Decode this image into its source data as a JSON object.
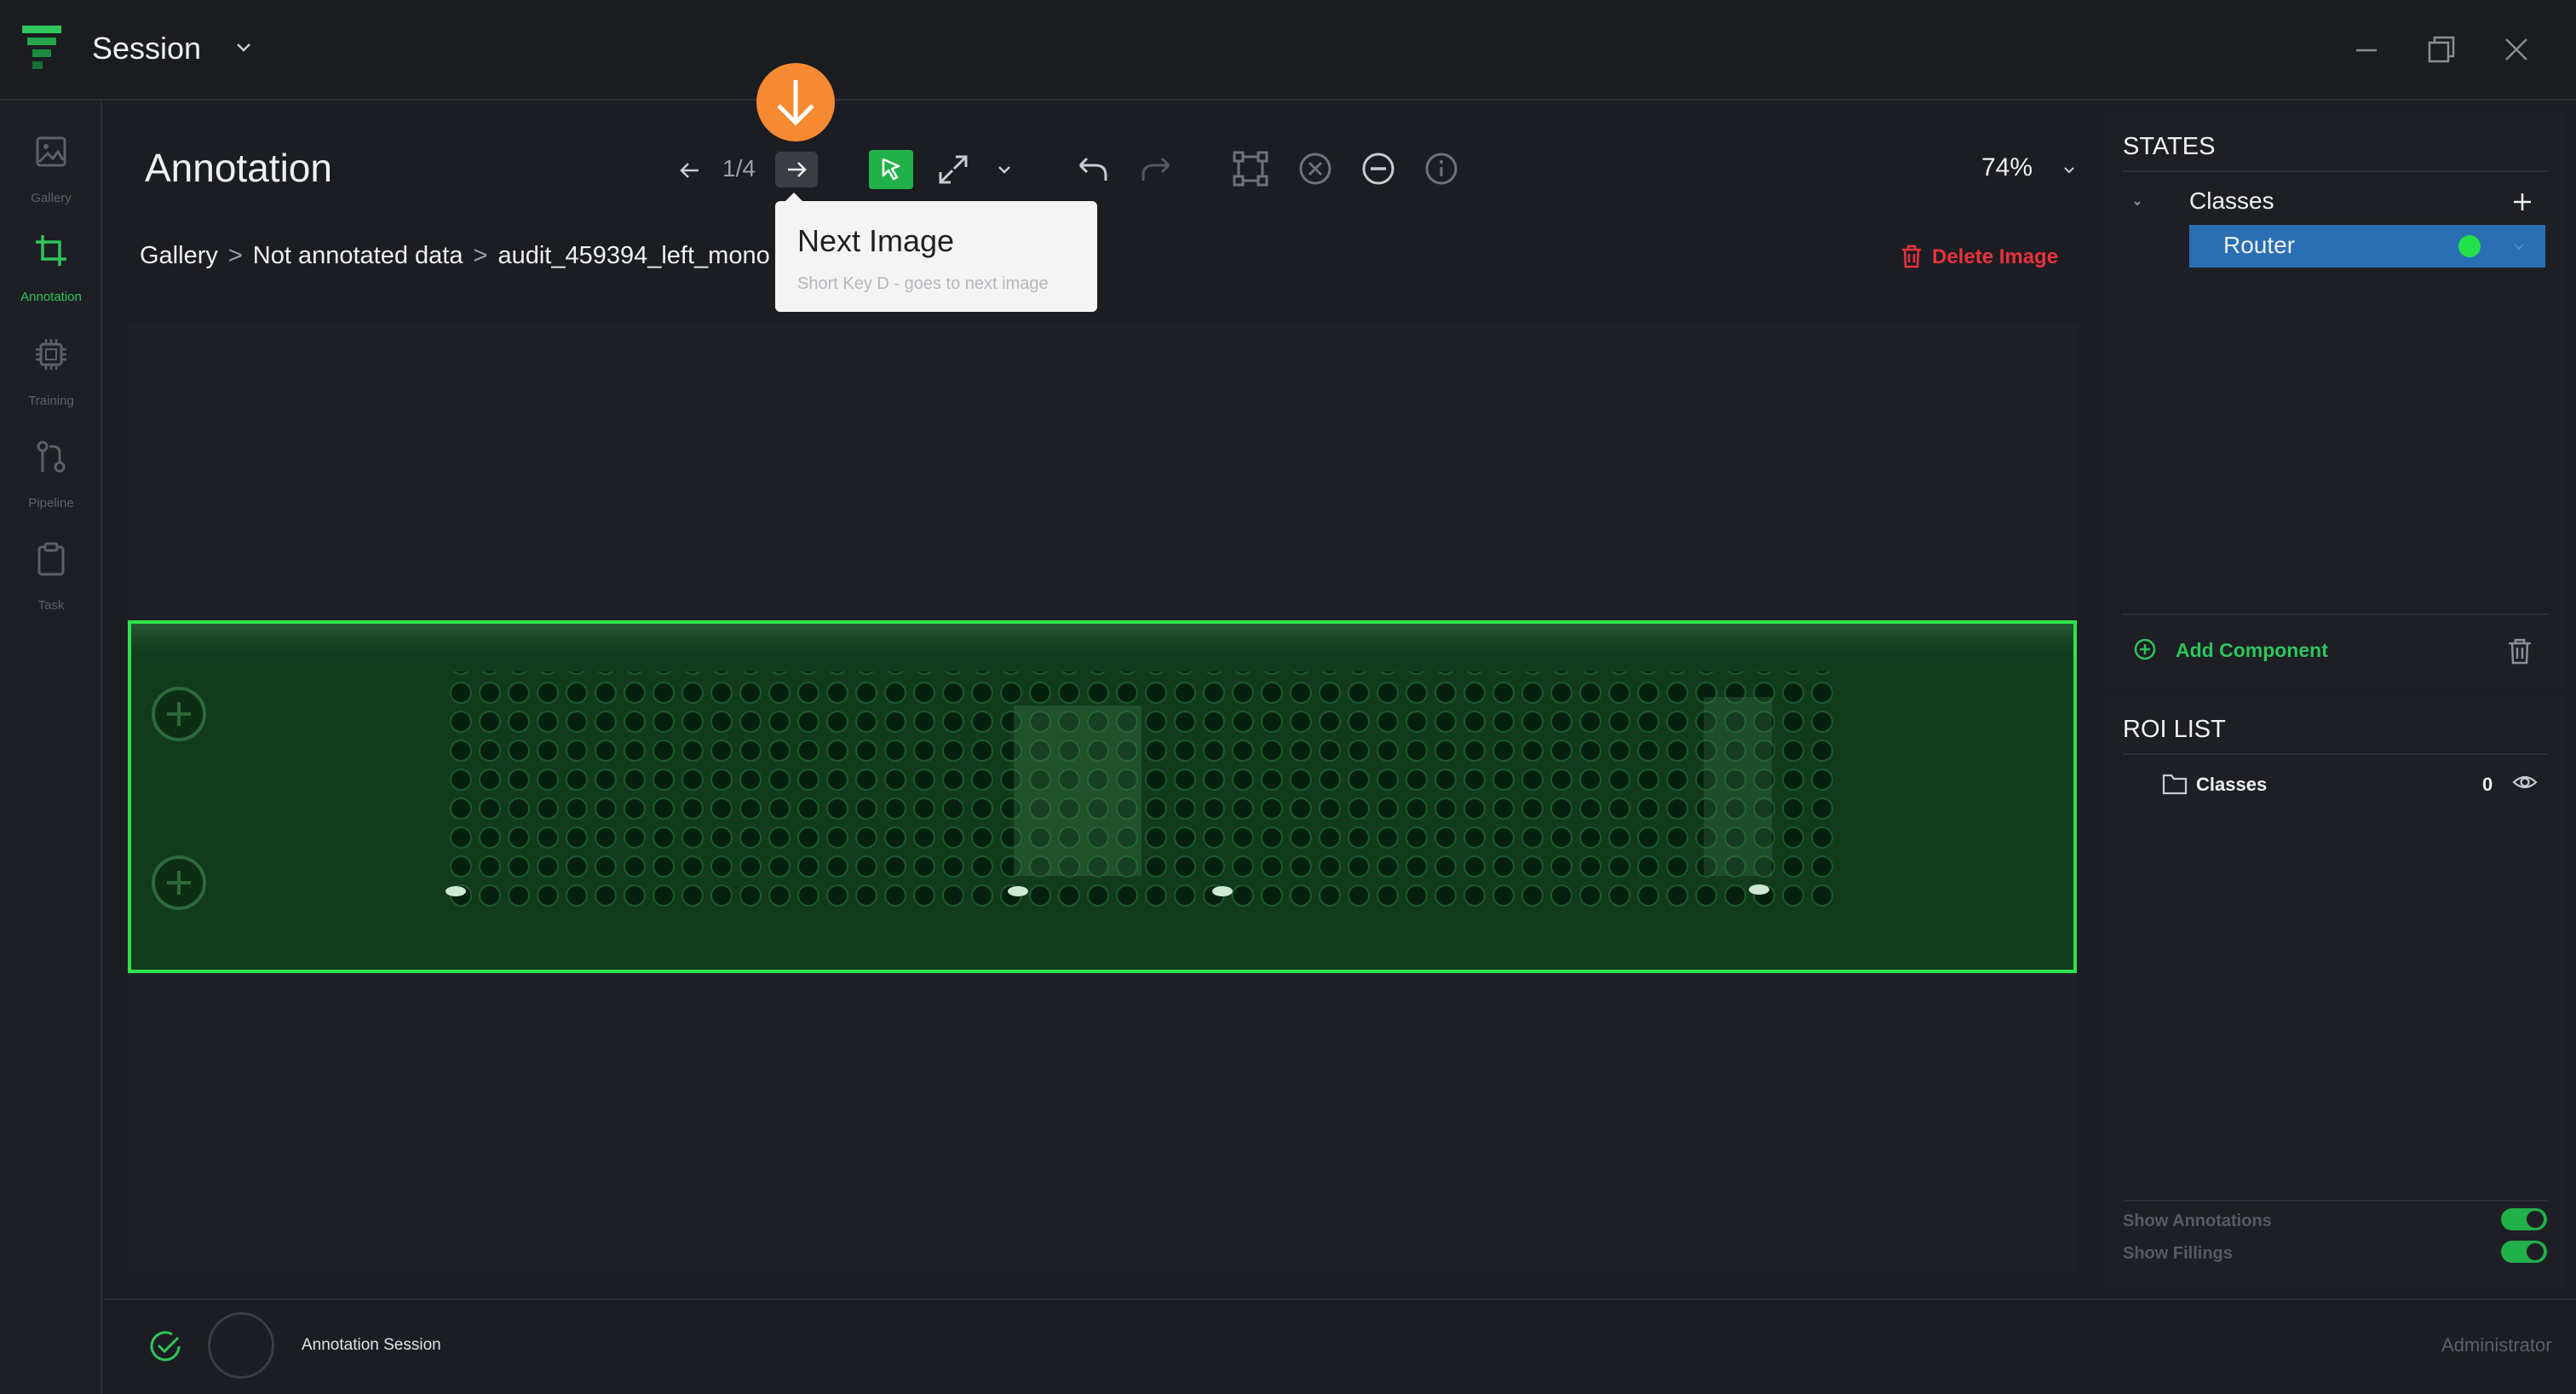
{
  "app": {
    "session_title": "Session"
  },
  "sidebar": {
    "items": [
      {
        "label": "Gallery"
      },
      {
        "label": "Annotation"
      },
      {
        "label": "Training"
      },
      {
        "label": "Pipeline"
      },
      {
        "label": "Task"
      }
    ]
  },
  "toolbar": {
    "title": "Annotation",
    "page_counter": "1/4",
    "zoom": "74%"
  },
  "tooltip": {
    "title": "Next Image",
    "description": "Short Key D - goes to next image"
  },
  "breadcrumb": {
    "items": [
      "Gallery",
      "Not annotated data",
      "audit_459394_left_mono"
    ],
    "separator": ">"
  },
  "delete_image_label": "Delete Image",
  "states_panel": {
    "title": "STATES",
    "classes_label": "Classes",
    "class_item": {
      "label": "Router",
      "color": "#22e04a"
    },
    "add_component_label": "Add Component"
  },
  "roi_panel": {
    "title": "ROI LIST",
    "item_label": "Classes",
    "item_count": "0",
    "show_annotations_label": "Show Annotations",
    "show_fillings_label": "Show Fillings"
  },
  "statusbar": {
    "session_label": "Annotation Session",
    "user_role": "Administrator"
  },
  "colors": {
    "accent": "#22b04a",
    "selection": "#2a6fb3",
    "danger": "#e8333f",
    "marker": "#f58a32"
  }
}
